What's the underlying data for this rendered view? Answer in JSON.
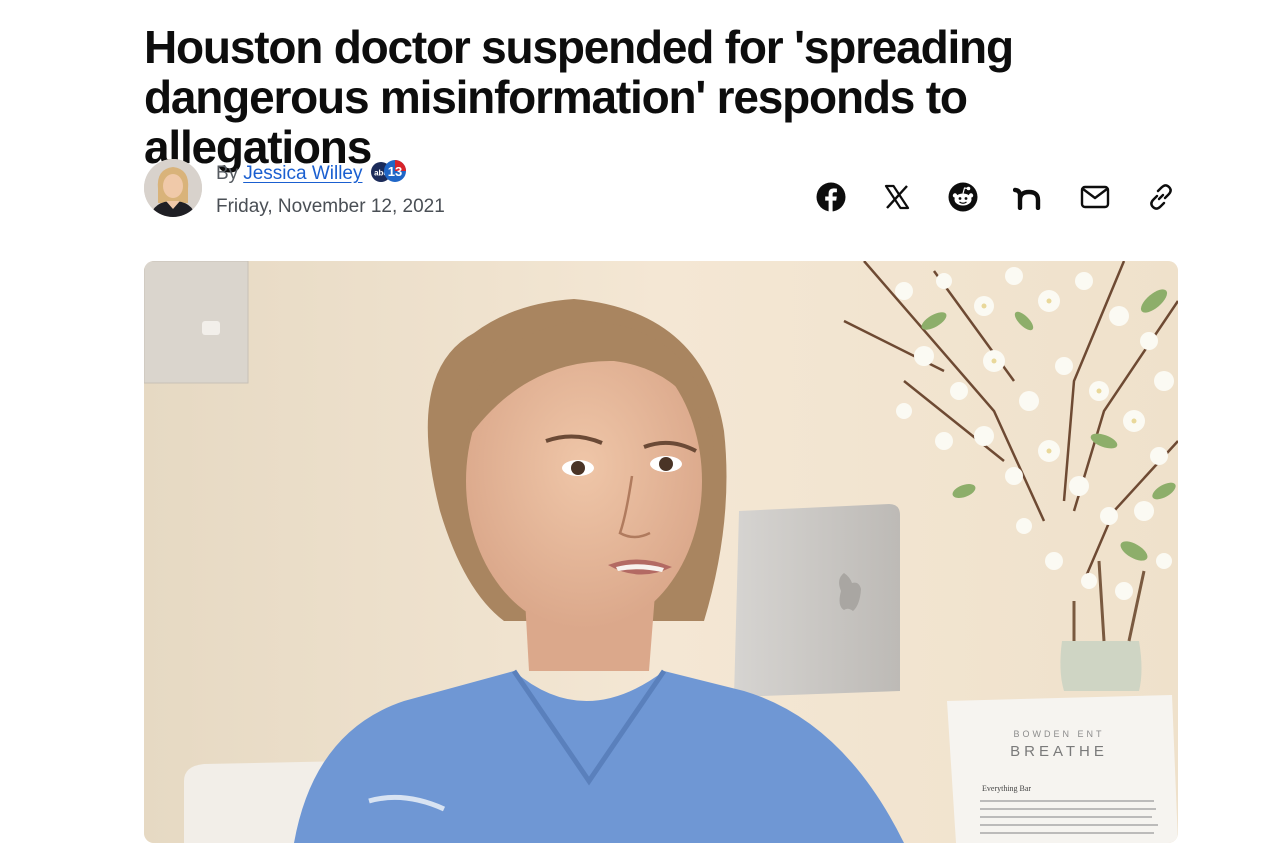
{
  "article": {
    "title": "Houston doctor suspended for 'spreading dangerous misinformation' responds to allegations",
    "byline": {
      "prefix": "By",
      "author": "Jessica Willey",
      "station": "abc13",
      "date": "Friday, November 12, 2021"
    },
    "share": [
      {
        "name": "facebook",
        "icon": "facebook-icon"
      },
      {
        "name": "x",
        "icon": "x-icon"
      },
      {
        "name": "reddit",
        "icon": "reddit-icon"
      },
      {
        "name": "nextdoor",
        "icon": "nextdoor-icon"
      },
      {
        "name": "email",
        "icon": "mail-icon"
      },
      {
        "name": "copy-link",
        "icon": "link-icon"
      }
    ],
    "hero_image": {
      "sign_small": "BOWDEN ENT",
      "sign_large": "BREATHE",
      "menu_heading": "Everything Bar"
    }
  },
  "colors": {
    "link": "#1a5fd0",
    "headline": "#0d0d0d",
    "meta": "#4a4f55",
    "scrubs": "#6f97d4"
  }
}
